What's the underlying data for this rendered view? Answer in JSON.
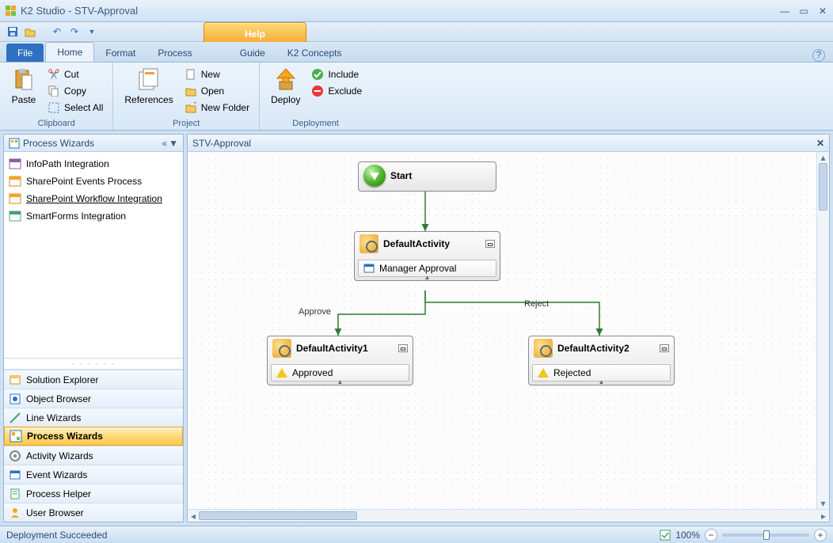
{
  "window": {
    "title": "K2 Studio - STV-Approval"
  },
  "ribbon": {
    "tabs": {
      "file": "File",
      "home": "Home",
      "format": "Format",
      "process": "Process",
      "guide": "Guide",
      "concepts": "K2 Concepts",
      "help": "Help"
    },
    "clipboard": {
      "paste": "Paste",
      "cut": "Cut",
      "copy": "Copy",
      "select_all": "Select All",
      "label": "Clipboard"
    },
    "project": {
      "references": "References",
      "new": "New",
      "open": "Open",
      "new_folder": "New Folder",
      "label": "Project"
    },
    "deploy": {
      "deploy": "Deploy",
      "include": "Include",
      "exclude": "Exclude",
      "label": "Deployment"
    }
  },
  "left_panel": {
    "header": "Process Wizards",
    "wizards": [
      {
        "label": "InfoPath Integration"
      },
      {
        "label": "SharePoint Events Process"
      },
      {
        "label": "SharePoint Workflow Integration",
        "selected": true
      },
      {
        "label": "SmartForms Integration"
      }
    ],
    "nav": [
      {
        "label": "Solution Explorer"
      },
      {
        "label": "Object Browser"
      },
      {
        "label": "Line Wizards"
      },
      {
        "label": "Process Wizards",
        "active": true
      },
      {
        "label": "Activity Wizards"
      },
      {
        "label": "Event Wizards"
      },
      {
        "label": "Process Helper"
      },
      {
        "label": "User Browser"
      }
    ]
  },
  "canvas": {
    "tab": "STV-Approval",
    "start": "Start",
    "default_activity": {
      "title": "DefaultActivity",
      "sub": "Manager Approval"
    },
    "activity1": {
      "title": "DefaultActivity1",
      "sub": "Approved"
    },
    "activity2": {
      "title": "DefaultActivity2",
      "sub": "Rejected"
    },
    "approve_label": "Approve",
    "reject_label": "Reject"
  },
  "status": {
    "message": "Deployment Succeeded",
    "zoom": "100%"
  }
}
